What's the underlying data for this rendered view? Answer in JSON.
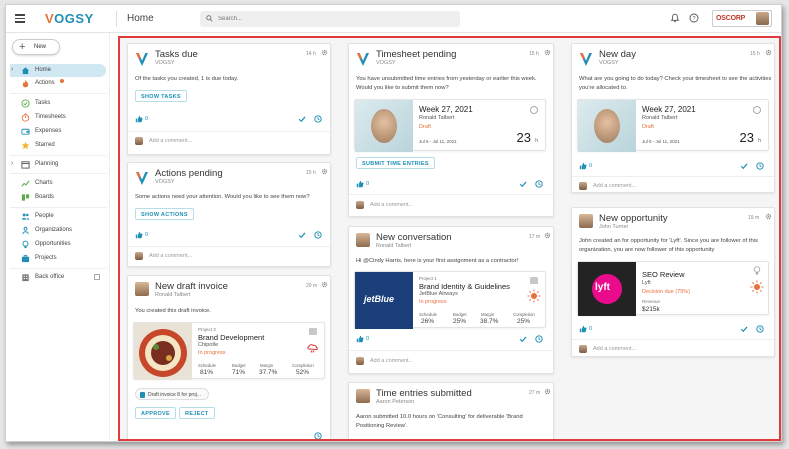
{
  "app": {
    "title": "Home",
    "search_placeholder": "Search...",
    "brand": "OSCORP",
    "logo_left": "V",
    "logo_right": "OGSY"
  },
  "sidebar": {
    "new_label": "New",
    "items": [
      {
        "label": "Home"
      },
      {
        "label": "Actions"
      },
      {
        "label": "Tasks"
      },
      {
        "label": "Timesheets"
      },
      {
        "label": "Expenses"
      },
      {
        "label": "Starred"
      },
      {
        "label": "Planning"
      },
      {
        "label": "Charts"
      },
      {
        "label": "Boards"
      },
      {
        "label": "People"
      },
      {
        "label": "Organizations"
      },
      {
        "label": "Opportunities"
      },
      {
        "label": "Projects"
      },
      {
        "label": "Back office"
      }
    ]
  },
  "cards": {
    "tasks_due": {
      "title": "Tasks due",
      "subtitle": "VOGSY",
      "time": "14 h",
      "body": "Of the tasks you created, 1 is due today.",
      "button": "SHOW TASKS",
      "likes": "0",
      "comment": "Add a comment..."
    },
    "actions_pending": {
      "title": "Actions pending",
      "subtitle": "VOGSY",
      "time": "15 h",
      "body": "Some actions need your attention. Would you like to see them now?",
      "button": "SHOW ACTIONS",
      "likes": "0",
      "comment": "Add a comment..."
    },
    "draft_invoice": {
      "title": "New draft invoice",
      "subtitle": "Ronald Talbert",
      "time": "20 m",
      "body": "You created this draft invoice.",
      "project": {
        "kicker": "Project 3",
        "name": "Brand Development",
        "client": "Chipotle",
        "status": "In progress",
        "m1t": "Schedule",
        "m1v": "81%",
        "m2t": "Budget",
        "m2v": "71%",
        "m3t": "Margin",
        "m3v": "37.7%",
        "m4t": "Completion",
        "m4v": "52%"
      },
      "file": "Draft invoice 8 for proj...",
      "approve": "APPROVE",
      "reject": "REJECT"
    },
    "timesheet_pending": {
      "title": "Timesheet pending",
      "subtitle": "VOGSY",
      "time": "15 h",
      "body1": "You have unsubmitted time entries from yesterday or earlier this week.",
      "body2": "Would you like to submit them now?",
      "week": {
        "title": "Week 27, 2021",
        "name": "Ronald Talbert",
        "status": "Draft",
        "dates": "Jul 5 - Jul 11, 2021",
        "hours": "23",
        "unit": "h"
      },
      "button": "SUBMIT TIME ENTRIES",
      "likes": "0",
      "comment": "Add a comment..."
    },
    "new_conversation": {
      "title": "New conversation",
      "subtitle": "Ronald Talbert",
      "time": "17 m",
      "body": "Hi @Cindy Harris, here is your first assignment as a contractor!",
      "project": {
        "kicker": "Project 1",
        "name": "Brand Identity & Guidelines",
        "client": "JetBlue Airways",
        "status": "In progress",
        "m1t": "Schedule",
        "m1v": "26%",
        "m2t": "Budget",
        "m2v": "25%",
        "m3t": "Margin",
        "m3v": "38.7%",
        "m4t": "Completion",
        "m4v": "25%"
      },
      "likes": "0",
      "comment": "Add a comment..."
    },
    "time_entries": {
      "title": "Time entries submitted",
      "subtitle": "Aaron Peterson",
      "time": "27 m",
      "body1": "Aaron submitted 10.0 hours on 'Consulting' for deliverable 'Brand",
      "body2": "Positioning Review'."
    },
    "new_day": {
      "title": "New day",
      "subtitle": "VOGSY",
      "time": "15 h",
      "body1": "What are you going to do today? Check your timesheet to see the activities",
      "body2": "you're allocated to.",
      "week": {
        "title": "Week 27, 2021",
        "name": "Ronald Talbert",
        "status": "Draft",
        "dates": "Jul 5 - Jul 11, 2021",
        "hours": "23",
        "unit": "h"
      },
      "likes": "0",
      "comment": "Add a comment..."
    },
    "new_opportunity": {
      "title": "New opportunity",
      "subtitle": "John Turner",
      "time": "19 m",
      "body1": "John created an for opportunity for 'Lyft'. Since you are follower of this",
      "body2": "organization, you are now follower of this opportunity",
      "opp": {
        "name": "SEO Review",
        "client": "Lyft",
        "status": "Decision due (75%)",
        "rev_label": "Revenue",
        "revenue": "$215k",
        "logo_text": "lyft"
      },
      "likes": "0",
      "comment": "Add a comment..."
    }
  },
  "jetblue_text": "jetBlue",
  "colors": {
    "accent": "#1f8fb6",
    "orange": "#e8703a",
    "highlight": "#e03c3c"
  }
}
